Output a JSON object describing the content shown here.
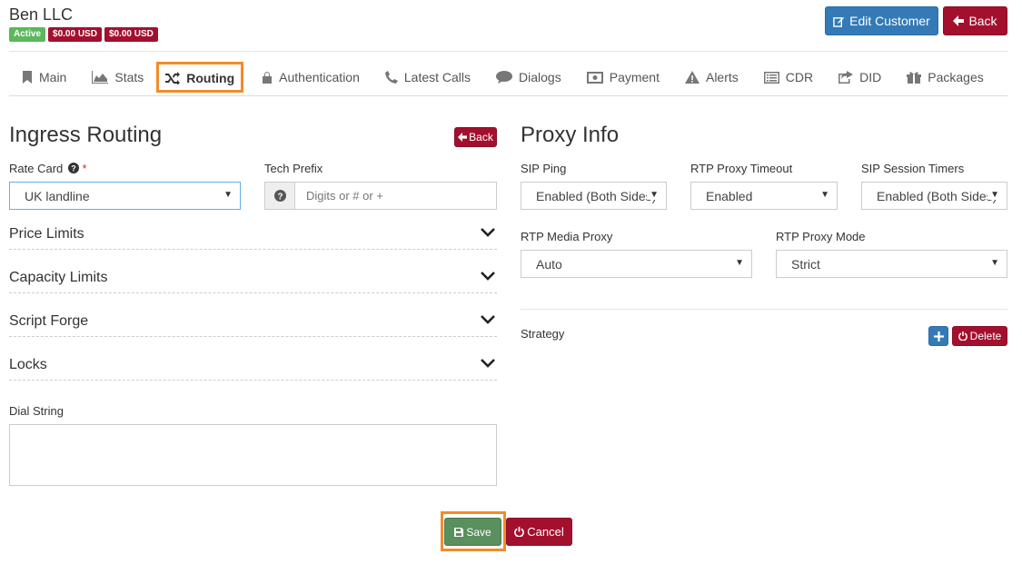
{
  "header": {
    "title": "Ben LLC",
    "badges": {
      "status": "Active",
      "balance1": "$0.00 USD",
      "balance2": "$0.00 USD"
    },
    "edit_label": "Edit Customer",
    "back_label": "Back"
  },
  "tabs": [
    {
      "label": "Main",
      "icon": "bookmark-icon"
    },
    {
      "label": "Stats",
      "icon": "area-chart-icon"
    },
    {
      "label": "Routing",
      "icon": "shuffle-icon",
      "active": true
    },
    {
      "label": "Authentication",
      "icon": "lock-icon"
    },
    {
      "label": "Latest Calls",
      "icon": "phone-icon"
    },
    {
      "label": "Dialogs",
      "icon": "comment-icon"
    },
    {
      "label": "Payment",
      "icon": "money-icon"
    },
    {
      "label": "Alerts",
      "icon": "warning-icon"
    },
    {
      "label": "CDR",
      "icon": "list-icon"
    },
    {
      "label": "DID",
      "icon": "share-icon"
    },
    {
      "label": "Packages",
      "icon": "gift-icon"
    }
  ],
  "ingress": {
    "title": "Ingress Routing",
    "back_label": "Back",
    "rate_card_label": "Rate Card",
    "rate_card_required": "*",
    "rate_card_value": "UK landline",
    "tech_prefix_label": "Tech Prefix",
    "tech_prefix_placeholder": "Digits or # or +",
    "sections": [
      "Price Limits",
      "Capacity Limits",
      "Script Forge",
      "Locks"
    ],
    "dial_string_label": "Dial String",
    "dial_string_value": ""
  },
  "proxy": {
    "title": "Proxy Info",
    "sip_ping_label": "SIP Ping",
    "sip_ping_value": "Enabled (Both Sides)",
    "rtp_timeout_label": "RTP Proxy Timeout",
    "rtp_timeout_value": "Enabled",
    "sip_timers_label": "SIP Session Timers",
    "sip_timers_value": "Enabled (Both Sides)",
    "rtp_media_label": "RTP Media Proxy",
    "rtp_media_value": "Auto",
    "rtp_mode_label": "RTP Proxy Mode",
    "rtp_mode_value": "Strict",
    "strategy_label": "Strategy",
    "delete_label": "Delete"
  },
  "footer": {
    "save_label": "Save",
    "cancel_label": "Cancel"
  },
  "colors": {
    "primary": "#337ab7",
    "danger": "#a3102e",
    "success": "#5a8f5e",
    "highlight": "#f28c28"
  }
}
